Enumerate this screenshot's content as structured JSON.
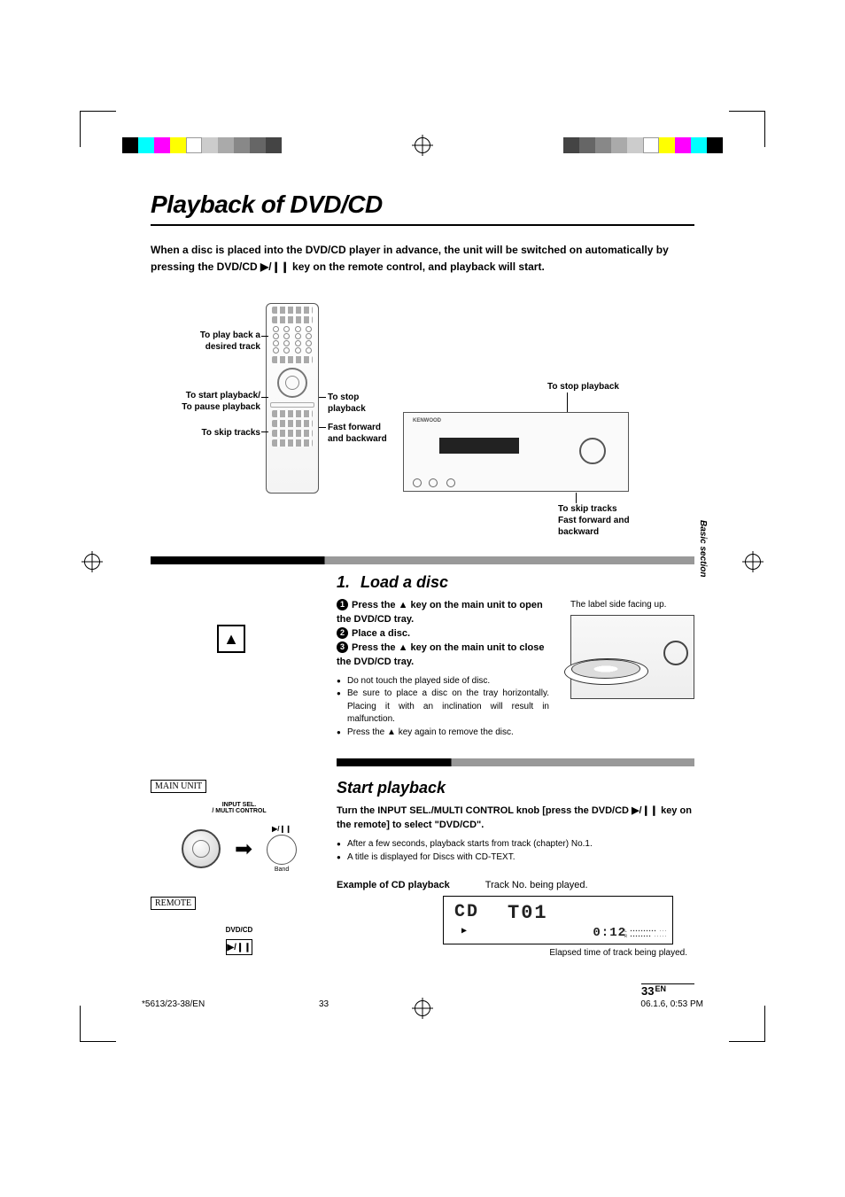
{
  "title": "Playback of DVD/CD",
  "intro_line1": "When a disc is placed into the DVD/CD player in advance, the unit will be switched on automatically by",
  "intro_line2_a": "pressing the DVD/CD ",
  "intro_line2_b": " key on the remote control, and playback will start.",
  "play_pause_glyph": "▶/❙❙",
  "diagram": {
    "label_playback_track": "To play back a\ndesired track",
    "label_start_pause": "To start playback/\nTo pause playback",
    "label_skip_tracks": "To skip tracks",
    "label_stop_playback_remote": "To stop\nplayback",
    "label_ff_rw": "Fast forward\nand backward",
    "label_stop_playback_unit": "To stop playback",
    "label_skip_ff_unit": "To skip tracks\nFast forward and\nbackward",
    "brand": "KENWOOD"
  },
  "side_tab": "Basic section",
  "sec1": {
    "num": "1.",
    "title": "Load a disc",
    "step1_a": "Press the ",
    "eject_glyph": "▲",
    "step1_b": " key on the main unit to open the DVD/CD tray.",
    "step2": "Place a disc.",
    "step3_a": "Press the ",
    "step3_b": " key on the main unit to close the DVD/CD tray.",
    "bullet1": "Do not touch the played side of disc.",
    "bullet2": "Be sure to place a disc on the tray horizontally. Placing it with an inclination will result in malfunction.",
    "bullet3_a": "Press the ",
    "bullet3_b": " key again to remove the disc.",
    "label_side": "The label side facing up."
  },
  "sec2": {
    "title": "Start playback",
    "main_unit_label": "MAIN UNIT",
    "remote_label": "REMOTE",
    "knob_caption": "INPUT SEL.\n/ MULTI CONTROL",
    "band_caption": "Band",
    "dvdcd_caption": "DVD/CD",
    "instr_a": "Turn the INPUT SEL./MULTI CONTROL knob [press the DVD/CD ",
    "instr_b": " key on the remote] to select \"DVD/CD\".",
    "bullet1": "After a few seconds, playback starts from track (chapter) No.1.",
    "bullet2": "A title is displayed for Discs with CD-TEXT.",
    "example_label": "Example of CD playback",
    "track_no_caption": "Track No. being played.",
    "display": {
      "cd": "CD",
      "track": "T01",
      "time": "0:12",
      "vu": "L ▪▪▪▪▪▪▪▪▪▪ ···\nR ▪▪▪▪▪▪▪▪ ·····"
    },
    "elapsed_caption": "Elapsed time of track being played."
  },
  "page_num": "33",
  "page_num_suffix": "EN",
  "footer": {
    "doc": "*5613/23-38/EN",
    "page": "33",
    "timestamp": "06.1.6, 0:53 PM"
  }
}
